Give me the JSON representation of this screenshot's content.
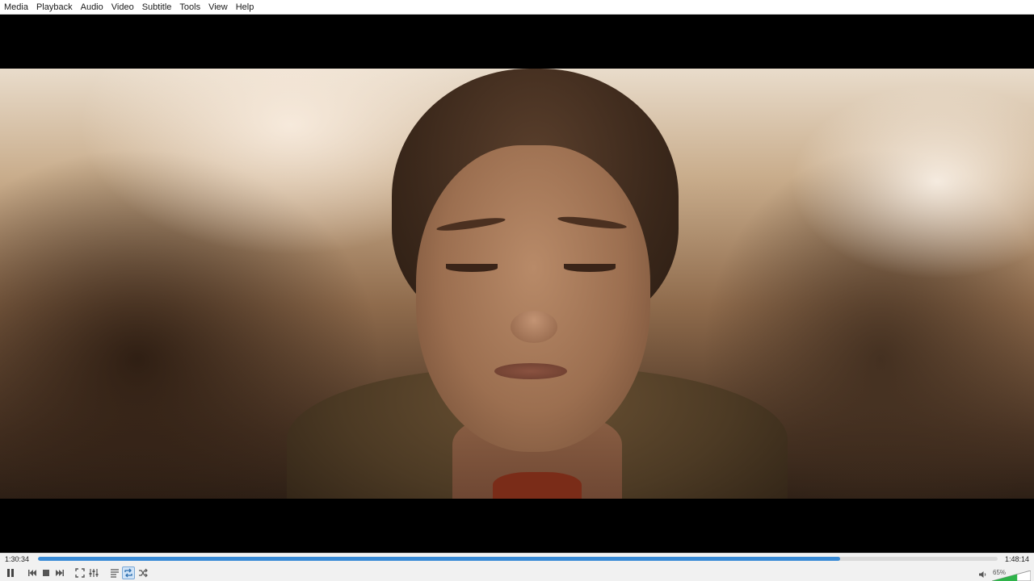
{
  "menu": {
    "items": [
      "Media",
      "Playback",
      "Audio",
      "Video",
      "Subtitle",
      "Tools",
      "View",
      "Help"
    ]
  },
  "player": {
    "elapsed": "1:30:34",
    "total": "1:48:14",
    "progress_fraction": 0.836,
    "volume_label": "65%",
    "volume_fraction": 0.65,
    "accent_color": "#3a8bd6",
    "volume_color": "#2fb34a"
  },
  "controls": {
    "buttons": [
      {
        "name": "pause-button",
        "icon": "pause-icon"
      },
      {
        "name": "previous-button",
        "icon": "skip-previous-icon"
      },
      {
        "name": "stop-button",
        "icon": "stop-icon"
      },
      {
        "name": "next-button",
        "icon": "skip-next-icon"
      },
      {
        "name": "fullscreen-button",
        "icon": "fullscreen-icon"
      },
      {
        "name": "extended-settings-button",
        "icon": "equalizer-icon"
      },
      {
        "name": "playlist-button",
        "icon": "playlist-icon"
      },
      {
        "name": "loop-button",
        "icon": "loop-icon",
        "active": true
      },
      {
        "name": "shuffle-button",
        "icon": "shuffle-icon"
      }
    ]
  }
}
